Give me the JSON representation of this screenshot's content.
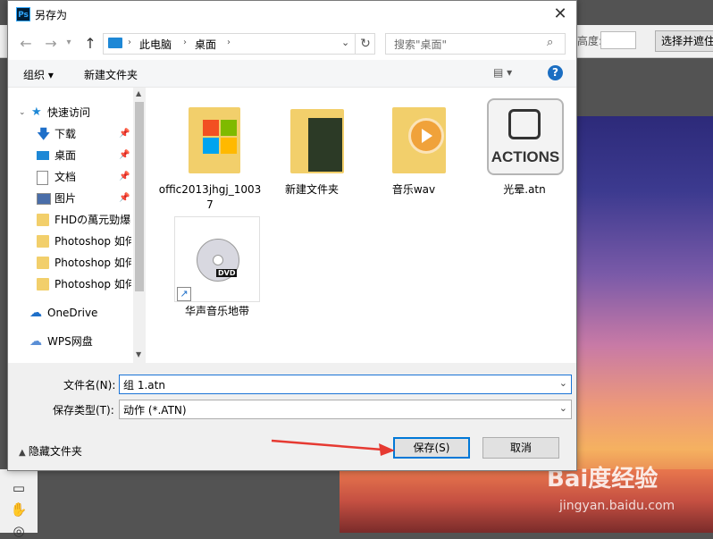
{
  "dialog": {
    "title": "另存为",
    "app_icon": "Ps"
  },
  "address": {
    "crumbs": [
      "此电脑",
      "桌面"
    ],
    "search_placeholder": "搜索\"桌面\""
  },
  "toolbar": {
    "organize": "组织 ▾",
    "new_folder": "新建文件夹"
  },
  "sidebar": {
    "items": [
      {
        "label": "快速访问"
      },
      {
        "label": "下载"
      },
      {
        "label": "桌面"
      },
      {
        "label": "文档"
      },
      {
        "label": "图片"
      },
      {
        "label": "FHDの萬元勁爆"
      },
      {
        "label": "Photoshop 如何"
      },
      {
        "label": "Photoshop 如何"
      },
      {
        "label": "Photoshop 如何"
      },
      {
        "label": "OneDrive"
      },
      {
        "label": "WPS网盘"
      }
    ]
  },
  "files": [
    {
      "name": "offic2013jhgj_10037",
      "icon": "office-folder-icon"
    },
    {
      "name": "新建文件夹",
      "icon": "folder-icon"
    },
    {
      "name": "音乐wav",
      "icon": "music-folder-icon"
    },
    {
      "name": "光晕.atn",
      "icon": "actions-file-icon",
      "icon_text": "ACTIONS"
    },
    {
      "name": "华声音乐地带",
      "icon": "dvd-shortcut-icon",
      "icon_text": "DVD"
    }
  ],
  "form": {
    "filename_label": "文件名(N):",
    "filename_value": "组 1.atn",
    "filetype_label": "保存类型(T):",
    "filetype_value": "动作 (*.ATN)",
    "hide_folders": "隐藏文件夹",
    "save": "保存(S)",
    "cancel": "取消"
  },
  "background": {
    "width_label": "高度:",
    "select_button": "选择并遮住",
    "watermark": "Bai度经验",
    "watermark_url": "jingyan.baidu.com"
  }
}
